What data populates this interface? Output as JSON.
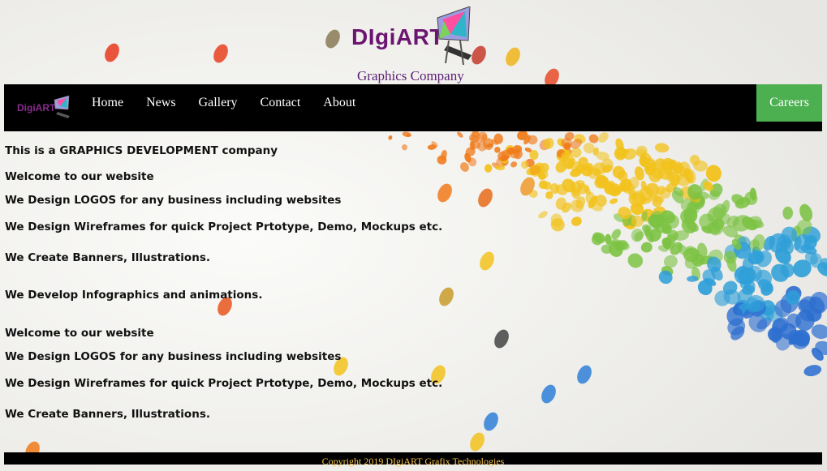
{
  "brand": {
    "logo_text": "DIgiART",
    "tagline": "Graphics Company"
  },
  "navbar": {
    "logo_text": "DigiART",
    "links": [
      "Home",
      "News",
      "Gallery",
      "Contact",
      "About"
    ],
    "cta_label": "Careers"
  },
  "content": {
    "lines": [
      "This is a GRAPHICS DEVELOPMENT company",
      "Welcome to our website",
      "We Design LOGOS for any business including websites",
      "We Design Wireframes for quick Project Prtotype, Demo, Mockups etc.",
      "We Create Banners, Illustrations.",
      "We Develop Infographics and animations.",
      "Welcome to our website",
      "We Design LOGOS for any business including websites",
      "We Design Wireframes for quick Project Prtotype, Demo, Mockups etc.",
      "We Create Banners, Illustrations."
    ]
  },
  "footer": {
    "copyright": "Copyright 2019 DIgiART Grafix Technologies"
  },
  "colors": {
    "navbar_bg": "#000000",
    "cta_bg": "#4caf50",
    "brand_purple": "#6b1470",
    "footer_text": "#f5c24c"
  }
}
